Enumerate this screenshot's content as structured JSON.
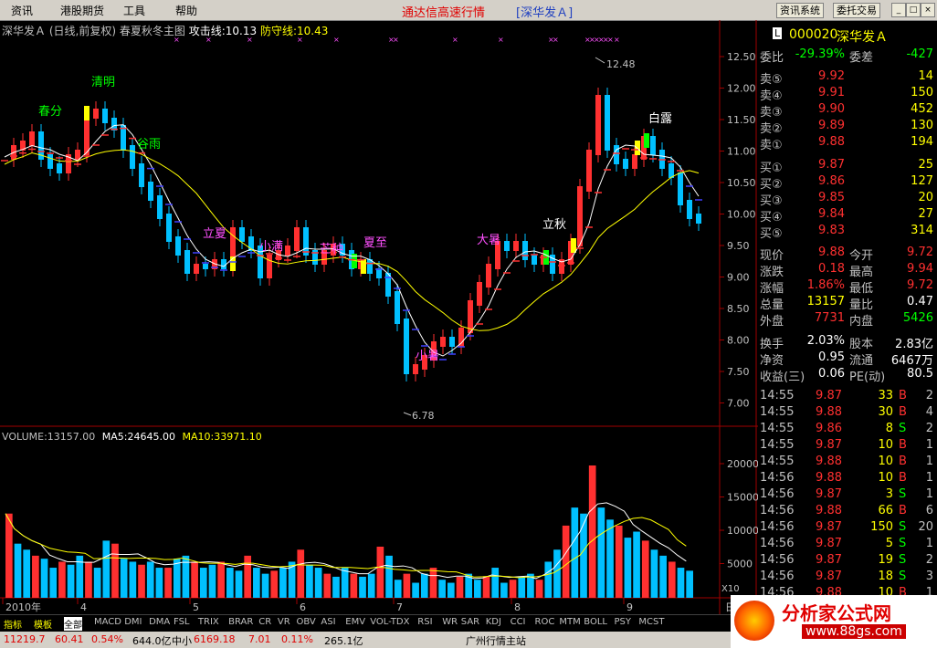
{
  "menu": {
    "items": [
      "资讯",
      "港股期货",
      "工具",
      "帮助"
    ],
    "title": "通达信高速行情",
    "title2": "[深华发Ａ]",
    "btn1": "资讯系统",
    "btn2": "委托交易"
  },
  "kchart": {
    "name": "深华发Ａ",
    "period": "(日线,前复权)",
    "indicator": "春夏秋冬主图",
    "attack_label": "攻击线:10.13",
    "defend_label": "防守线:10.43",
    "price_ticks": [
      "12.50",
      "12.00",
      "11.50",
      "11.00",
      "10.50",
      "10.00",
      "9.50",
      "9.00",
      "8.50",
      "8.00",
      "7.50",
      "7.00"
    ],
    "high_mark": "12.48",
    "low_mark": "6.78",
    "terms": [
      "春分",
      "清明",
      "谷雨",
      "立夏",
      "小满",
      "芒种",
      "夏至",
      "小暑",
      "大暑",
      "立秋",
      "白露"
    ]
  },
  "volume": {
    "header_vol": "VOLUME:13157.00",
    "header_ma5": "MA5:24645.00",
    "header_ma10": "MA10:33971.10",
    "ticks": [
      "20000",
      "15000",
      "10000",
      "5000"
    ],
    "multiplier": "X10"
  },
  "xaxis": {
    "labels": [
      "2010年",
      "4",
      "5",
      "6",
      "7",
      "8",
      "9"
    ],
    "period_label": "日线"
  },
  "quote": {
    "code": "000020",
    "name": "深华发Ａ",
    "weibi_label": "委比",
    "weibi": "-29.39%",
    "weicha_label": "委差",
    "weicha": "-427",
    "sells": [
      {
        "label": "卖⑤",
        "price": "9.92",
        "vol": "14"
      },
      {
        "label": "卖④",
        "price": "9.91",
        "vol": "150"
      },
      {
        "label": "卖③",
        "price": "9.90",
        "vol": "452"
      },
      {
        "label": "卖②",
        "price": "9.89",
        "vol": "130"
      },
      {
        "label": "卖①",
        "price": "9.88",
        "vol": "194"
      }
    ],
    "buys": [
      {
        "label": "买①",
        "price": "9.87",
        "vol": "25"
      },
      {
        "label": "买②",
        "price": "9.86",
        "vol": "127"
      },
      {
        "label": "买③",
        "price": "9.85",
        "vol": "20"
      },
      {
        "label": "买④",
        "price": "9.84",
        "vol": "27"
      },
      {
        "label": "买⑤",
        "price": "9.83",
        "vol": "314"
      }
    ],
    "stats": [
      {
        "l1": "现价",
        "v1": "9.88",
        "l2": "今开",
        "v2": "9.72"
      },
      {
        "l1": "涨跌",
        "v1": "0.18",
        "l2": "最高",
        "v2": "9.94"
      },
      {
        "l1": "涨幅",
        "v1": "1.86%",
        "l2": "最低",
        "v2": "9.72"
      },
      {
        "l1": "总量",
        "v1": "13157",
        "l2": "量比",
        "v2": "0.47"
      },
      {
        "l1": "外盘",
        "v1": "7731",
        "l2": "内盘",
        "v2": "5426"
      }
    ],
    "stats2": [
      {
        "l1": "换手",
        "v1": "2.03%",
        "l2": "股本",
        "v2": "2.83亿"
      },
      {
        "l1": "净资",
        "v1": "0.95",
        "l2": "流通",
        "v2": "6467万"
      },
      {
        "l1": "收益(三)",
        "v1": "0.06",
        "l2": "PE(动)",
        "v2": "80.5"
      }
    ],
    "ticks": [
      {
        "time": "14:55",
        "price": "9.87",
        "vol": "33",
        "side": "B",
        "n": "2"
      },
      {
        "time": "14:55",
        "price": "9.88",
        "vol": "30",
        "side": "B",
        "n": "4"
      },
      {
        "time": "14:55",
        "price": "9.86",
        "vol": "8",
        "side": "S",
        "n": "2"
      },
      {
        "time": "14:55",
        "price": "9.87",
        "vol": "10",
        "side": "B",
        "n": "1"
      },
      {
        "time": "14:55",
        "price": "9.88",
        "vol": "10",
        "side": "B",
        "n": "1"
      },
      {
        "time": "14:56",
        "price": "9.88",
        "vol": "10",
        "side": "B",
        "n": "1"
      },
      {
        "time": "14:56",
        "price": "9.87",
        "vol": "3",
        "side": "S",
        "n": "1"
      },
      {
        "time": "14:56",
        "price": "9.88",
        "vol": "66",
        "side": "B",
        "n": "6"
      },
      {
        "time": "14:56",
        "price": "9.87",
        "vol": "150",
        "side": "S",
        "n": "20"
      },
      {
        "time": "14:56",
        "price": "9.87",
        "vol": "5",
        "side": "S",
        "n": "1"
      },
      {
        "time": "14:56",
        "price": "9.87",
        "vol": "19",
        "side": "S",
        "n": "2"
      },
      {
        "time": "14:56",
        "price": "9.87",
        "vol": "18",
        "side": "S",
        "n": "3"
      },
      {
        "time": "14:56",
        "price": "9.88",
        "vol": "10",
        "side": "B",
        "n": "1"
      },
      {
        "time": "15:00",
        "price": "9.88",
        "vol": "607",
        "side": "",
        "n": "43"
      }
    ]
  },
  "tabs": [
    "指标",
    "模板",
    "全部",
    "MACD",
    "DMI",
    "DMA",
    "FSL",
    "TRIX",
    "BRAR",
    "CR",
    "VR",
    "OBV",
    "ASI",
    "EMV",
    "VOL-TDX",
    "RSI",
    "WR",
    "SAR",
    "KDJ",
    "CCI",
    "ROC",
    "MTM",
    "BOLL",
    "PSY",
    "MCST"
  ],
  "status": {
    "index1": "11219.7",
    "chg1": "60.41",
    "pct1": "0.54%",
    "amt1": "644.0亿",
    "index2_name": "中小",
    "index2": "6169.18",
    "chg2": "7.01",
    "pct2": "0.11%",
    "amt2": "265.1亿",
    "site": "广州行情主站"
  },
  "logo": {
    "text": "分析家公式网",
    "url": "www.88gs.com"
  },
  "colors": {
    "up": "#ff3030",
    "down": "#00c0ff",
    "yellow": "#ffff00",
    "green": "#00ff00",
    "magenta": "#ff50ff"
  }
}
